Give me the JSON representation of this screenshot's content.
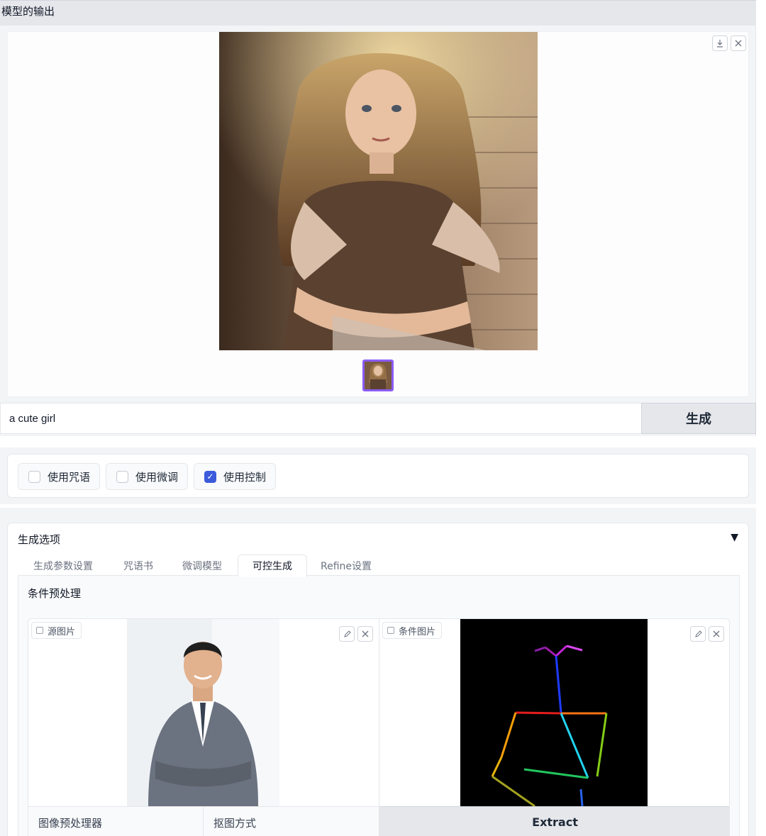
{
  "output": {
    "title": "模型的输出",
    "download_icon": "download-icon",
    "close_icon": "close-icon",
    "main_image_desc": "girl",
    "thumbnail_selected": true
  },
  "prompt": {
    "value": "a cute girl",
    "generate_label": "生成"
  },
  "toggles": [
    {
      "label": "使用咒语",
      "checked": false
    },
    {
      "label": "使用微调",
      "checked": false
    },
    {
      "label": "使用控制",
      "checked": true
    }
  ],
  "options": {
    "title": "生成选项",
    "caret": "▼",
    "tabs": [
      "生成参数设置",
      "咒语书",
      "微调模型",
      "可控生成",
      "Refine设置"
    ],
    "active_tab": "可控生成",
    "section_title": "条件预处理",
    "source_image_label": "源图片",
    "condition_image_label": "条件图片",
    "preprocessor_label": "图像预处理器",
    "matting_label": "抠图方式",
    "extract_label": "Extract"
  },
  "colors": {
    "accent_purple": "#8b5cf6",
    "checkbox_blue": "#3b5bdb",
    "panel_bg": "#f3f4f6"
  }
}
